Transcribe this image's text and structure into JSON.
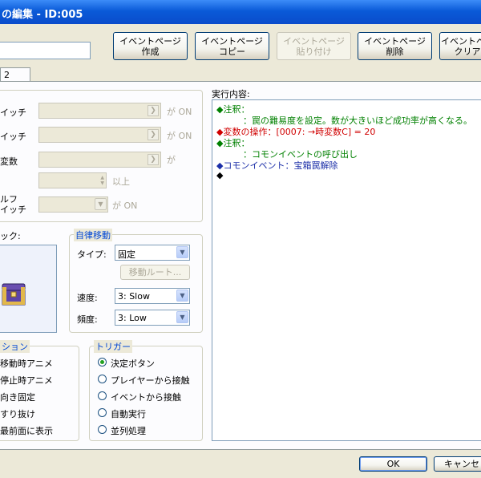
{
  "window": {
    "title": "の編集 - ID:005"
  },
  "toolbar": {
    "create_page": "イベントページ\n作成",
    "copy_page": "イベントページ\nコピー",
    "paste_page": "イベントページ\n貼り付け",
    "delete_page": "イベントページ\n削除",
    "clear_page": "イベントペー\nクリア"
  },
  "name_field": {
    "value": ""
  },
  "tabs": [
    {
      "label": "2"
    }
  ],
  "conditions": {
    "switch1_label": "イッチ",
    "switch2_label": "イッチ",
    "variable_label": "変数",
    "self_switch_label": "ルフ\nイッチ",
    "ga_on": "が ON",
    "ga": "が",
    "ijou": "以上"
  },
  "graphic": {
    "label": "ック:"
  },
  "autonomous": {
    "title": "自律移動",
    "type_label": "タイプ:",
    "type_value": "固定",
    "route_button": "移動ルート...",
    "speed_label": "速度:",
    "speed_value": "3: Slow",
    "freq_label": "頻度:",
    "freq_value": "3: Low"
  },
  "options": {
    "title": "ション",
    "items": [
      "移動時アニメ",
      "停止時アニメ",
      "向き固定",
      "すり抜け",
      "最前面に表示"
    ]
  },
  "trigger": {
    "title": "トリガー",
    "items": [
      "決定ボタン",
      "プレイヤーから接触",
      "イベントから接触",
      "自動実行",
      "並列処理"
    ],
    "selected": 0
  },
  "contents": {
    "label": "実行内容:",
    "lines": [
      {
        "text": "◆注釈：",
        "color": "#008000"
      },
      {
        "text": "　　　：罠の難易度を設定。数が大きいほど成功率が高くなる。",
        "color": "#008000"
      },
      {
        "text": "◆変数の操作：[0007: →時変数C] = 20",
        "color": "#d00000"
      },
      {
        "text": "◆注釈：",
        "color": "#008000"
      },
      {
        "text": "　　　：コモンイベントの呼び出し",
        "color": "#008000"
      },
      {
        "text": "◆コモンイベント：宝箱罠解除",
        "color": "#1c2fa8"
      },
      {
        "text": "◆",
        "color": "#000000"
      }
    ]
  },
  "footer": {
    "ok": "OK",
    "cancel": "キャンセ"
  }
}
